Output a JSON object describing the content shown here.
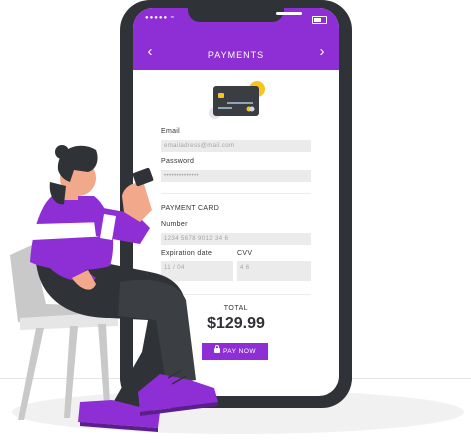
{
  "colors": {
    "accent": "#8e2fd5",
    "phone_body": "#2f3236",
    "field_bg": "#ebebeb",
    "card_gold": "#f7c51e"
  },
  "header": {
    "title": "PAYMENTS",
    "prev_icon": "chevron-left-icon",
    "next_icon": "chevron-right-icon"
  },
  "status_bar": {
    "signal": "●●●●● ≈",
    "battery_icon": "battery-icon"
  },
  "form": {
    "email_label": "Email",
    "email_value": "emailadress@mail.com",
    "password_label": "Password",
    "password_value": "••••••••••••••",
    "section_title": "PAYMENT CARD",
    "number_label": "Number",
    "number_value": "1234  5678  9012  34  6",
    "expiration_label": "Expiration date",
    "expiration_value": "11 / 04",
    "cvv_label": "CVV",
    "cvv_value": "4  6"
  },
  "summary": {
    "total_label": "TOTAL",
    "total_amount": "$129.99",
    "pay_label": "PAY NOW"
  }
}
